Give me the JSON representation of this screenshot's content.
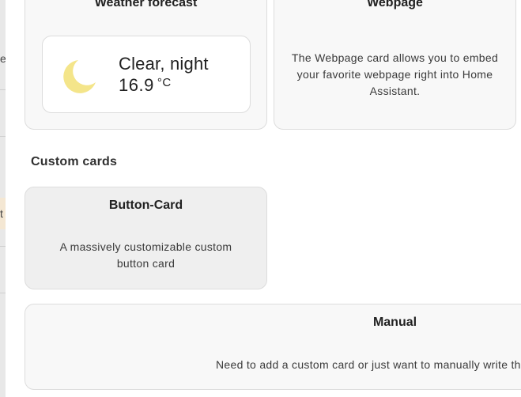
{
  "background_fragments": {
    "top_letter": "e",
    "middle_letter": "t"
  },
  "weather_card": {
    "title": "Weather forecast",
    "condition": "Clear, night",
    "temperature": "16.9",
    "unit": "°C",
    "icon": "moon-icon",
    "icon_color": "#f4e58a"
  },
  "webpage_card": {
    "title": "Webpage",
    "description": "The Webpage card allows you to embed your favorite webpage right into Home Assistant."
  },
  "custom_section": {
    "title": "Custom cards"
  },
  "button_card": {
    "title": "Button-Card",
    "description": "A massively customizable custom button card"
  },
  "manual_card": {
    "title": "Manual",
    "description": "Need to add a custom card or just want to manually write the yaml?"
  }
}
